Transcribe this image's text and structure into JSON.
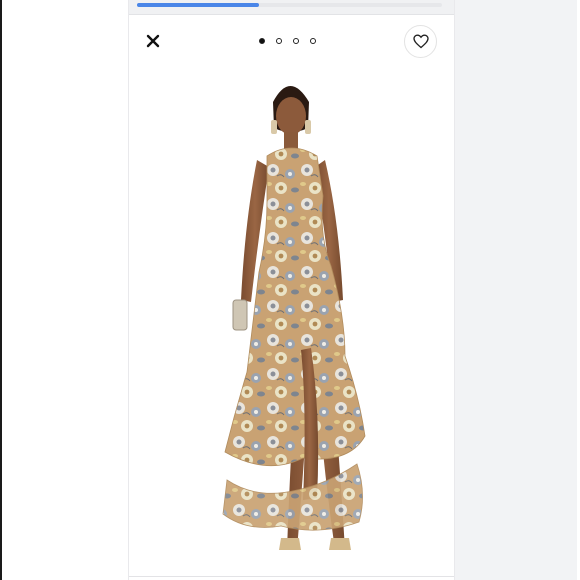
{
  "progress": {
    "fraction": 0.4
  },
  "carousel": {
    "total": 4,
    "active": 0
  },
  "icons": {
    "close": "close-icon",
    "favorite": "heart-icon"
  },
  "colors": {
    "accent": "#4a86e8",
    "dress_base": "#c9a273",
    "skin": "#8a5a3a"
  }
}
